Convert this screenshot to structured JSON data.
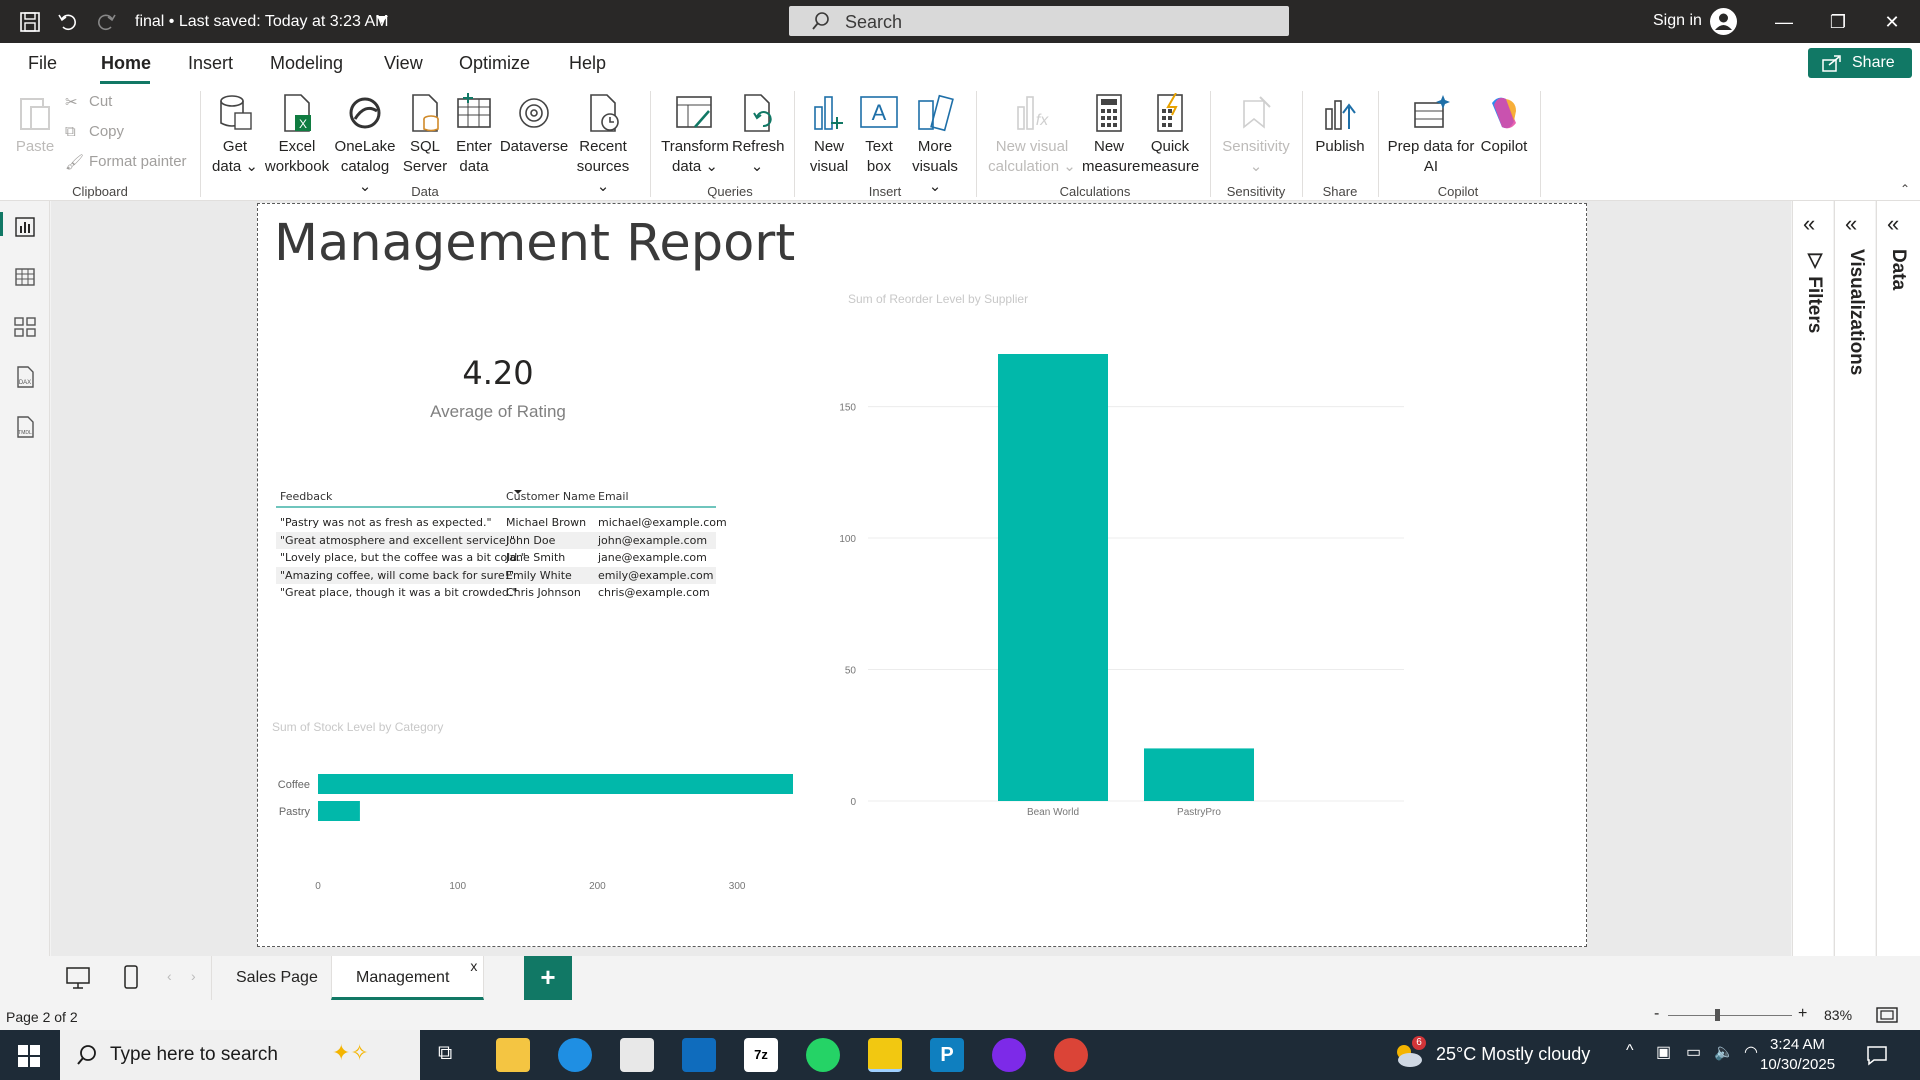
{
  "titlebar": {
    "title": "final • Last saved: Today at 3:23 AM",
    "search_placeholder": "Search",
    "signin": "Sign in"
  },
  "menu": {
    "tabs": [
      "File",
      "Home",
      "Insert",
      "Modeling",
      "View",
      "Optimize",
      "Help"
    ],
    "active": "Home",
    "share": "Share"
  },
  "ribbon": {
    "clipboard": {
      "paste": "Paste",
      "cut": "Cut",
      "copy": "Copy",
      "format_painter": "Format painter",
      "group": "Clipboard"
    },
    "data": {
      "get_data": "Get data",
      "excel": "Excel workbook",
      "onelake": "OneLake catalog",
      "sql": "SQL Server",
      "enter": "Enter data",
      "dataverse": "Dataverse",
      "recent": "Recent sources",
      "group": "Data"
    },
    "queries": {
      "transform": "Transform data",
      "refresh": "Refresh",
      "group": "Queries"
    },
    "insert": {
      "new_visual": "New visual",
      "text_box": "Text box",
      "more_visuals": "More visuals",
      "group": "Insert"
    },
    "calculations": {
      "new_visual_calc": "New visual calculation",
      "new_measure": "New measure",
      "quick_measure": "Quick measure",
      "group": "Calculations"
    },
    "sensitivity": {
      "sensitivity": "Sensitivity",
      "group": "Sensitivity"
    },
    "share": {
      "publish": "Publish",
      "group": "Share"
    },
    "copilot": {
      "prep": "Prep data for AI",
      "copilot": "Copilot",
      "group": "Copilot"
    }
  },
  "report": {
    "title": "Management Report",
    "card": {
      "value": "4.20",
      "label": "Average of Rating"
    },
    "table": {
      "headers": [
        "Feedback",
        "Customer Name",
        "Email"
      ],
      "rows": [
        [
          "\"Pastry was not as fresh as expected.\"",
          "Michael Brown",
          "michael@example.com"
        ],
        [
          "\"Great atmosphere and excellent service!\"",
          "John Doe",
          "john@example.com"
        ],
        [
          "\"Lovely place, but the coffee was a bit cold.\"",
          "Jane Smith",
          "jane@example.com"
        ],
        [
          "\"Amazing coffee, will come back for sure!\"",
          "Emily White",
          "emily@example.com"
        ],
        [
          "\"Great place, though it was a bit crowded.\"",
          "Chris Johnson",
          "chris@example.com"
        ]
      ]
    }
  },
  "chart_data": [
    {
      "type": "bar",
      "title": "Sum of Stock Level by Category",
      "orientation": "horizontal",
      "categories": [
        "Coffee",
        "Pastry"
      ],
      "values": [
        340,
        30
      ],
      "xlim": [
        0,
        340
      ],
      "ticks": [
        0,
        100,
        200,
        300
      ],
      "color": "#01b8aa"
    },
    {
      "type": "bar",
      "title": "Sum of Reorder Level by Supplier",
      "orientation": "vertical",
      "categories": [
        "Bean World",
        "PastryPro"
      ],
      "values": [
        170,
        20
      ],
      "ylim": [
        0,
        170
      ],
      "ticks": [
        0,
        50,
        100,
        150
      ],
      "grid": true,
      "color": "#01b8aa"
    }
  ],
  "panes": {
    "filters": "Filters",
    "visualizations": "Visualizations",
    "data": "Data"
  },
  "pages": {
    "tabs": [
      "Sales Page",
      "Management"
    ],
    "active": "Management",
    "close": "x",
    "add": "+"
  },
  "status": {
    "page": "Page 2 of 2",
    "zoom": "83%"
  },
  "taskbar": {
    "search": "Type here to search",
    "weather": "25°C  Mostly cloudy",
    "weather_badge": "6",
    "time": "3:24 AM",
    "date": "10/30/2025"
  }
}
